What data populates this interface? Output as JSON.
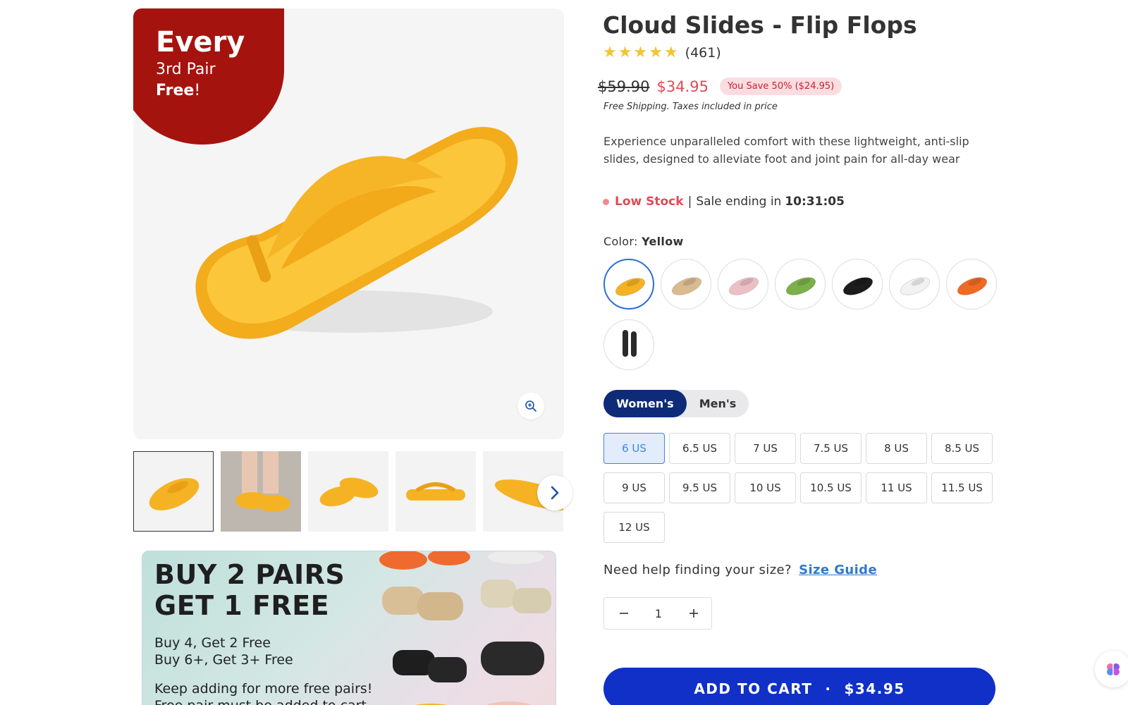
{
  "gallery": {
    "promo_badge": {
      "line1": "Every",
      "line2": "3rd Pair",
      "line3_bold": "Free",
      "line3_rest": "!"
    },
    "hero_color": "#f5b324",
    "zoom_icon": "zoom-in-icon",
    "next_icon": "chevron-right-icon"
  },
  "bundle": {
    "headline_1": "BUY 2 PAIRS",
    "headline_2": "GET 1 FREE",
    "line_1": "Buy 4, Get 2 Free",
    "line_2": "Buy 6+, Get 3+ Free",
    "line_3": "Keep adding for more free pairs!",
    "line_4": "Free pair must be added to cart"
  },
  "product": {
    "title": "Cloud Slides - Flip Flops",
    "rating_stars": 5,
    "review_count": "(461)",
    "old_price": "$59.90",
    "new_price": "$34.95",
    "savings": "You Save 50%  ($24.95)",
    "shipping_note": "Free Shipping. Taxes included in price",
    "description": "Experience unparalleled comfort with these lightweight, anti-slip slides, designed to alleviate foot and joint pain for all-day wear",
    "stock_label": "Low Stock",
    "sale_text": "Sale ending in",
    "countdown": "10:31:05"
  },
  "color": {
    "label": "Color:",
    "selected": "Yellow",
    "swatch_colors": [
      "#f5b324",
      "#d9bb90",
      "#ecbfc7",
      "#7bb04a",
      "#1c1c1c",
      "#f2f2f2",
      "#f06a25",
      "#2a2a2a"
    ]
  },
  "gender": {
    "options": [
      "Women's",
      "Men's"
    ],
    "selected": "Women's"
  },
  "sizes": {
    "options": [
      "6 US",
      "6.5 US",
      "7 US",
      "7.5 US",
      "8 US",
      "8.5 US",
      "9 US",
      "9.5 US",
      "10 US",
      "10.5 US",
      "11 US",
      "11.5 US",
      "12 US"
    ],
    "selected": "6 US"
  },
  "size_help": {
    "prompt": "Need help finding your size?",
    "link": "Size Guide"
  },
  "quantity": {
    "value": "1"
  },
  "cart": {
    "label": "ADD TO CART",
    "separator": "·",
    "price": "$34.95"
  },
  "colors": {
    "brand_blue": "#1030c8",
    "navy": "#0e2b78",
    "sale_red": "#e24a55",
    "badge_red": "#a5130f",
    "star_yellow": "#f2c530"
  }
}
